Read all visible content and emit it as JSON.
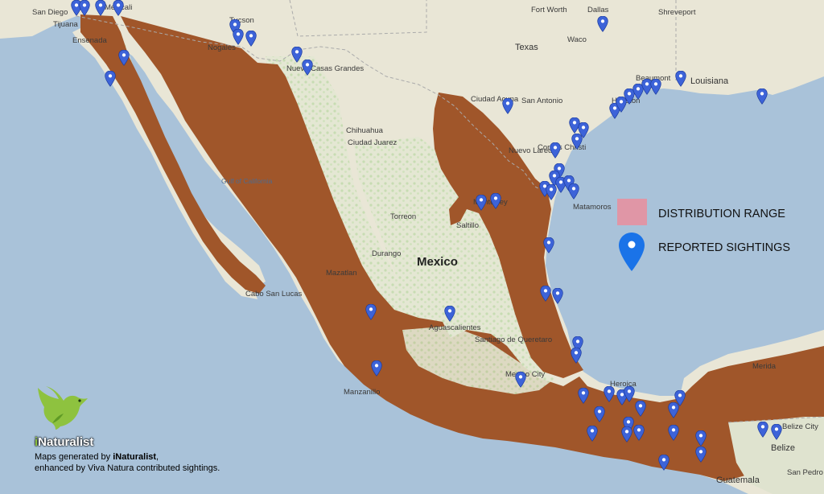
{
  "map": {
    "country_label": "Mexico",
    "state_labels": [
      "Texas",
      "Louisiana"
    ],
    "city_labels": [
      "San Diego",
      "Tijuana",
      "Ensenada",
      "Mexicali",
      "Tucson",
      "Nogales",
      "Nuevo Casas Grandes",
      "Ciudad Juarez",
      "Chihuahua",
      "Fort Worth",
      "Dallas",
      "Waco",
      "Shreveport",
      "San Antonio",
      "Ciudad Acuna",
      "Corpus Christi",
      "Nuevo Laredo",
      "Monterrey",
      "Matamoros",
      "Torreon",
      "Saltillo",
      "Durango",
      "Mazatlan",
      "Aguascalientes",
      "Santiago de Queretaro",
      "Manzanillo",
      "Mexico City",
      "Heroica",
      "Merida",
      "Cabo San Lucas",
      "Belize City",
      "Belize",
      "San Pedro Sula",
      "Guatemala",
      "Houston",
      "Beaumont"
    ],
    "water_labels": [
      "Gulf of California"
    ]
  },
  "legend": {
    "range_label": "DISTRIBUTION RANGE",
    "range_color": "#e096a6",
    "sightings_label": "REPORTED SIGHTINGS",
    "sightings_color": "#1a73e8",
    "range_fill_color": "#a0562a"
  },
  "credit": {
    "brand_i": "i",
    "brand_rest": "Naturalist",
    "line1_prefix": "Maps generated by ",
    "line1_brand": "iNaturalist",
    "line1_suffix": ",",
    "line2": "enhanced by Viva Natura contributed sightings."
  }
}
